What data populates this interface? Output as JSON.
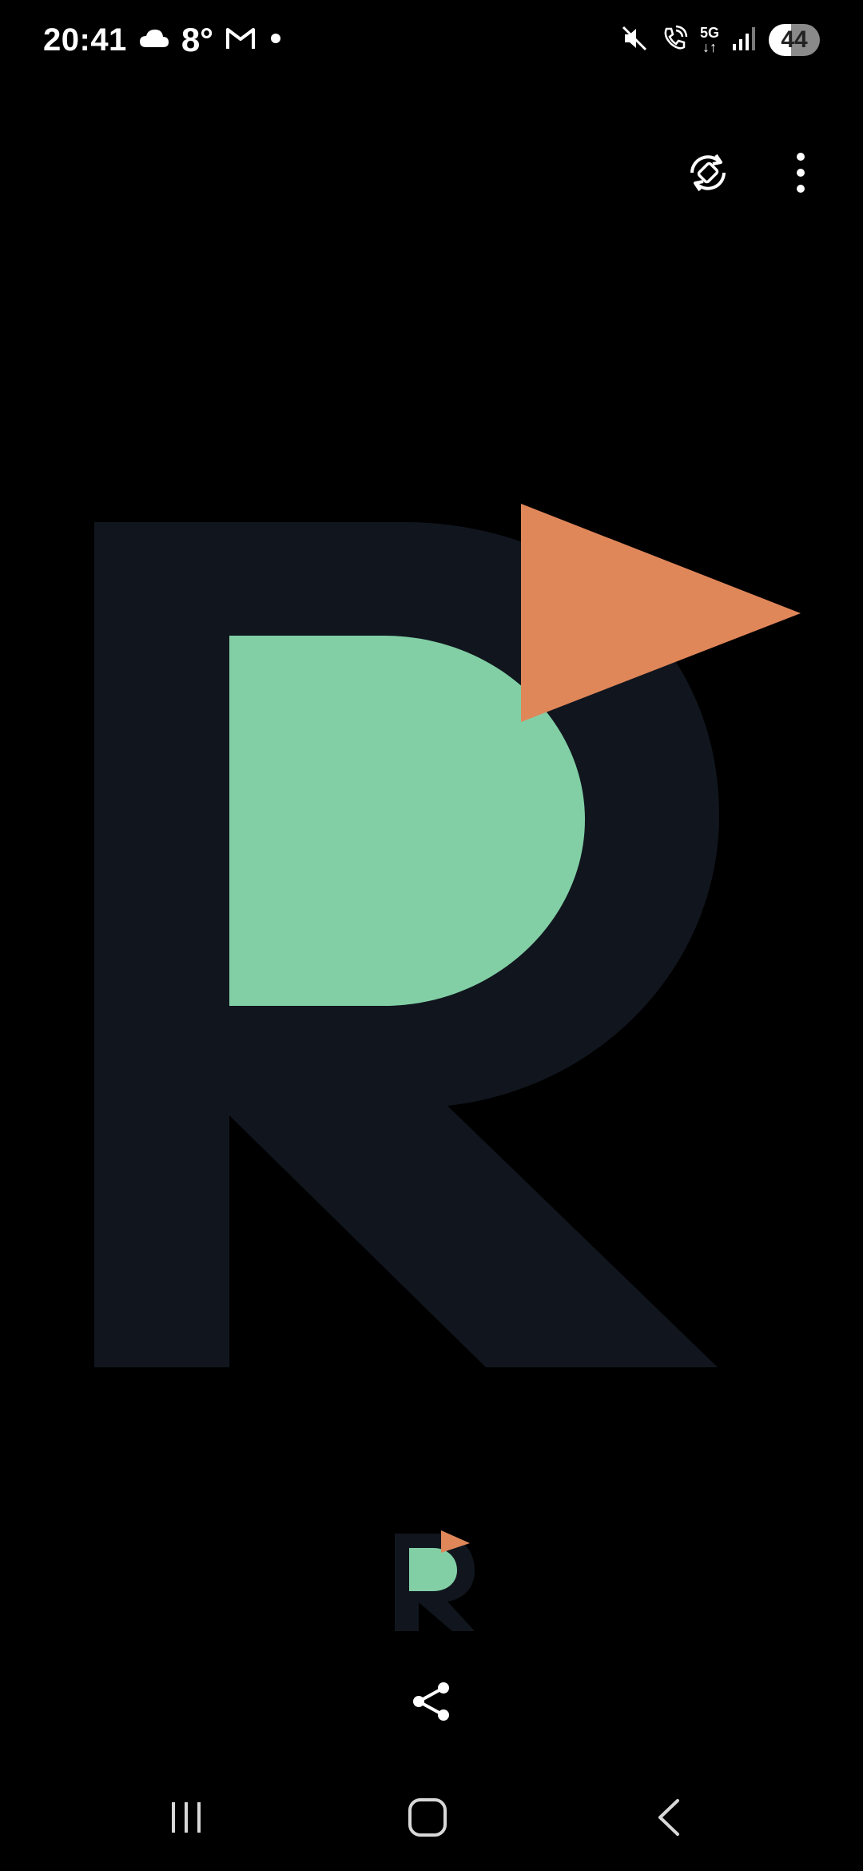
{
  "status_bar": {
    "time": "20:41",
    "weather_icon": "cloud-icon",
    "temperature": "8°",
    "notification_icons": [
      "gmail-icon",
      "dot-icon"
    ],
    "right_icons": [
      "mute-icon",
      "wifi-call-icon",
      "5g-icon",
      "signal-icon"
    ],
    "network_label": "5G",
    "battery_level": "44"
  },
  "top_actions": {
    "icons": [
      "rotate-icon",
      "more-vert-icon"
    ]
  },
  "logo": {
    "letter_color": "#11161e",
    "bowl_color": "#82cfa6",
    "flag_color": "#e0875a"
  },
  "share": {
    "icon": "share-icon"
  },
  "nav_bar": {
    "icons": [
      "recent-apps-icon",
      "home-icon",
      "back-icon"
    ]
  }
}
